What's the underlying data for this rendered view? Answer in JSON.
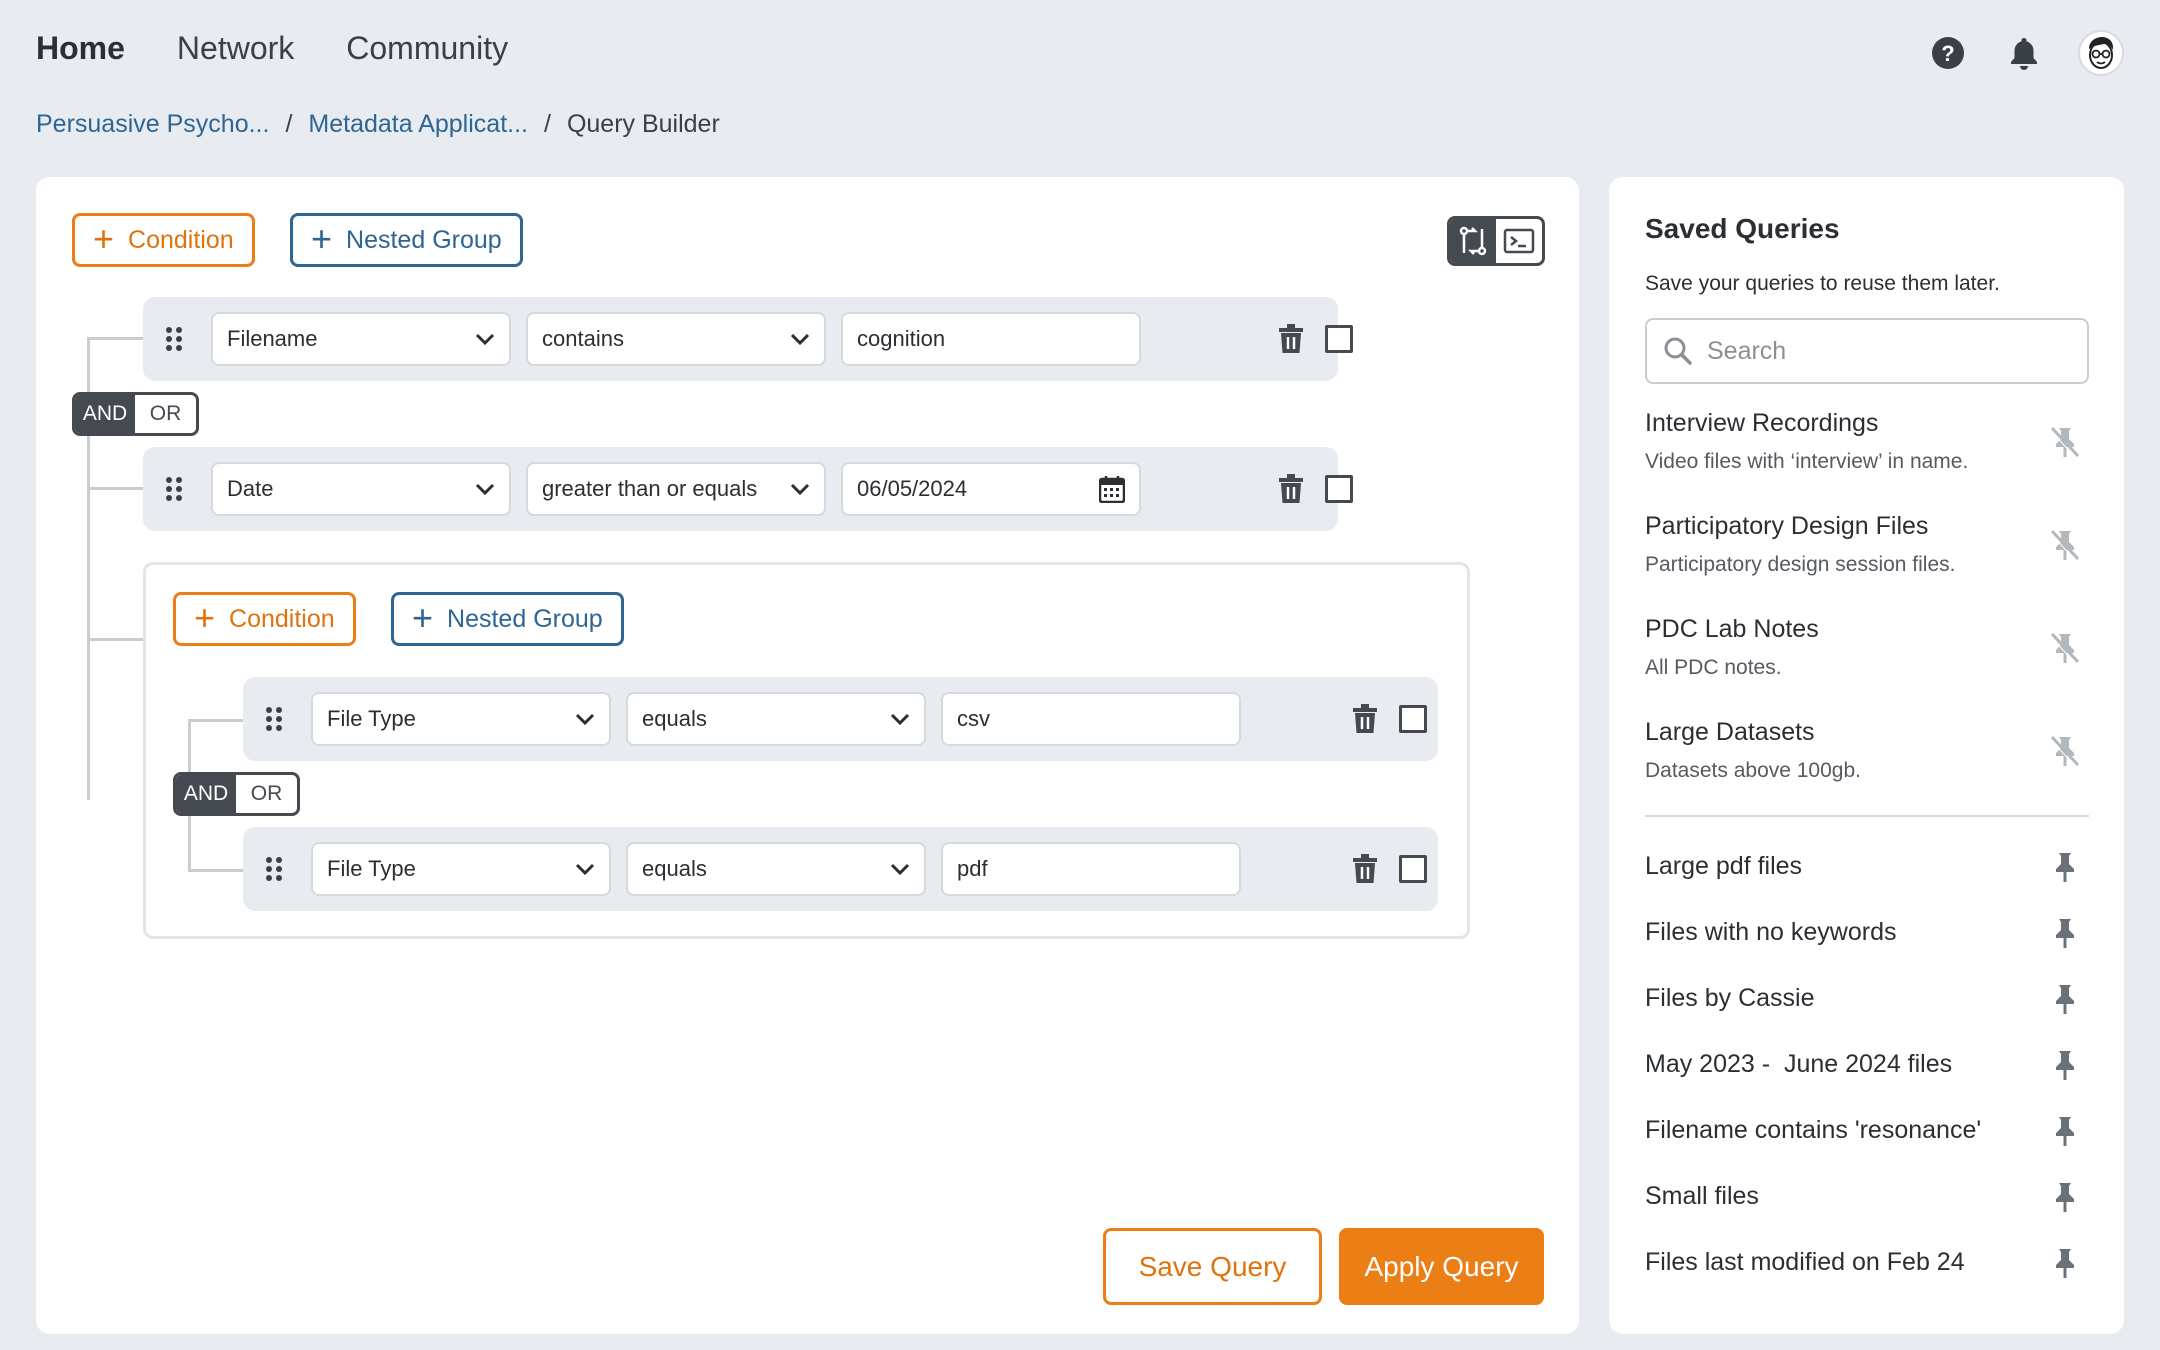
{
  "nav": {
    "items": [
      {
        "label": "Home"
      },
      {
        "label": "Network"
      },
      {
        "label": "Community"
      }
    ]
  },
  "breadcrumb": {
    "items": [
      "Persuasive Psycho...",
      "Metadata Applicat...",
      "Query Builder"
    ]
  },
  "toolbar": {
    "add_condition": "Condition",
    "add_nested_group": "Nested Group"
  },
  "logic": {
    "and": "AND",
    "or": "OR"
  },
  "conditions": [
    {
      "field": "Filename",
      "operator": "contains",
      "value": "cognition"
    },
    {
      "field": "Date",
      "operator": "greater than or equals",
      "value": "06/05/2024"
    }
  ],
  "nested_group": {
    "add_condition": "Condition",
    "add_nested_group": "Nested Group",
    "conditions": [
      {
        "field": "File Type",
        "operator": "equals",
        "value": "csv"
      },
      {
        "field": "File Type",
        "operator": "equals",
        "value": "pdf"
      }
    ]
  },
  "actions": {
    "save": "Save Query",
    "apply": "Apply Query"
  },
  "saved_queries": {
    "title": "Saved Queries",
    "subtitle": "Save your queries to reuse them later.",
    "search_placeholder": "Search",
    "pinned": [
      {
        "name": "Interview Recordings",
        "desc": "Video files with ‘interview’ in name."
      },
      {
        "name": "Participatory Design Files",
        "desc": "Participatory design session files."
      },
      {
        "name": "PDC Lab Notes",
        "desc": "All PDC notes."
      },
      {
        "name": "Large Datasets",
        "desc": "Datasets above 100gb."
      }
    ],
    "others": [
      {
        "name": "Large pdf files"
      },
      {
        "name": "Files with no keywords"
      },
      {
        "name": "Files by Cassie"
      },
      {
        "name": "May 2023 -  June 2024 files"
      },
      {
        "name": "Filename contains 'resonance'"
      },
      {
        "name": "Small files"
      },
      {
        "name": "Files last modified on Feb 24"
      }
    ]
  },
  "colors": {
    "accent_orange": "#ec7e16",
    "link_blue": "#2e6593",
    "dark": "#454a50",
    "background": "#e8ecf1"
  }
}
